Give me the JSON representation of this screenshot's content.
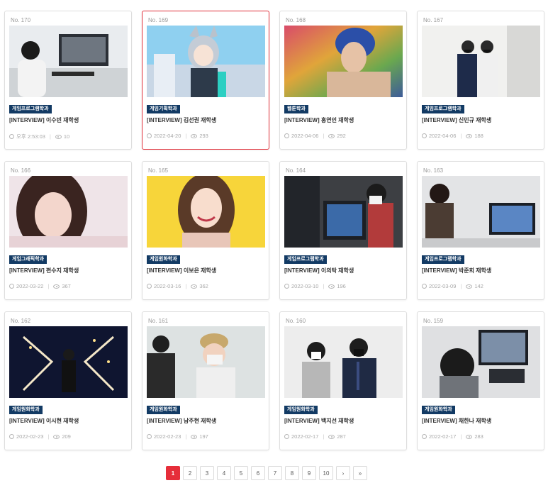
{
  "cards": [
    {
      "no": "No. 170",
      "dept": "게임프로그램학과",
      "title": "[INTERVIEW] 이수빈 재학생",
      "date": "오후 2:53:03",
      "views": "10"
    },
    {
      "no": "No. 169",
      "dept": "게임기획학과",
      "title": "[INTERVIEW] 김선권 재학생",
      "date": "2022-04-20",
      "views": "293"
    },
    {
      "no": "No. 168",
      "dept": "웹툰학과",
      "title": "[INTERVIEW] 홍연인 재학생",
      "date": "2022-04-06",
      "views": "292"
    },
    {
      "no": "No. 167",
      "dept": "게임프로그램학과",
      "title": "[INTERVIEW] 신민규 재학생",
      "date": "2022-04-06",
      "views": "188"
    },
    {
      "no": "No. 166",
      "dept": "게임그래픽학과",
      "title": "[INTERVIEW] 편수지 재학생",
      "date": "2022-03-22",
      "views": "367"
    },
    {
      "no": "No. 165",
      "dept": "게임원화학과",
      "title": "[INTERVIEW] 이보은 재학생",
      "date": "2022-03-16",
      "views": "362"
    },
    {
      "no": "No. 164",
      "dept": "게임프로그램학과",
      "title": "[INTERVIEW] 이의탁 재학생",
      "date": "2022-03-10",
      "views": "196"
    },
    {
      "no": "No. 163",
      "dept": "게임프로그램학과",
      "title": "[INTERVIEW] 박준희 재학생",
      "date": "2022-03-09",
      "views": "142"
    },
    {
      "no": "No. 162",
      "dept": "게임원화학과",
      "title": "[INTERVIEW] 이시현 재학생",
      "date": "2022-02-23",
      "views": "209"
    },
    {
      "no": "No. 161",
      "dept": "게임원화학과",
      "title": "[INTERVIEW] 남주현 재학생",
      "date": "2022-02-23",
      "views": "197"
    },
    {
      "no": "No. 160",
      "dept": "게임원화학과",
      "title": "[INTERVIEW] 백지선 재학생",
      "date": "2022-02-17",
      "views": "287"
    },
    {
      "no": "No. 159",
      "dept": "게임원화학과",
      "title": "[INTERVIEW] 채한나 재학생",
      "date": "2022-02-17",
      "views": "283"
    }
  ],
  "pagination": {
    "pages": [
      "1",
      "2",
      "3",
      "4",
      "5",
      "6",
      "7",
      "8",
      "9",
      "10"
    ],
    "current": "1",
    "next": "›",
    "last": "»"
  },
  "colors": {
    "accent": "#e62e3a",
    "dept_badge": "#123a64"
  }
}
